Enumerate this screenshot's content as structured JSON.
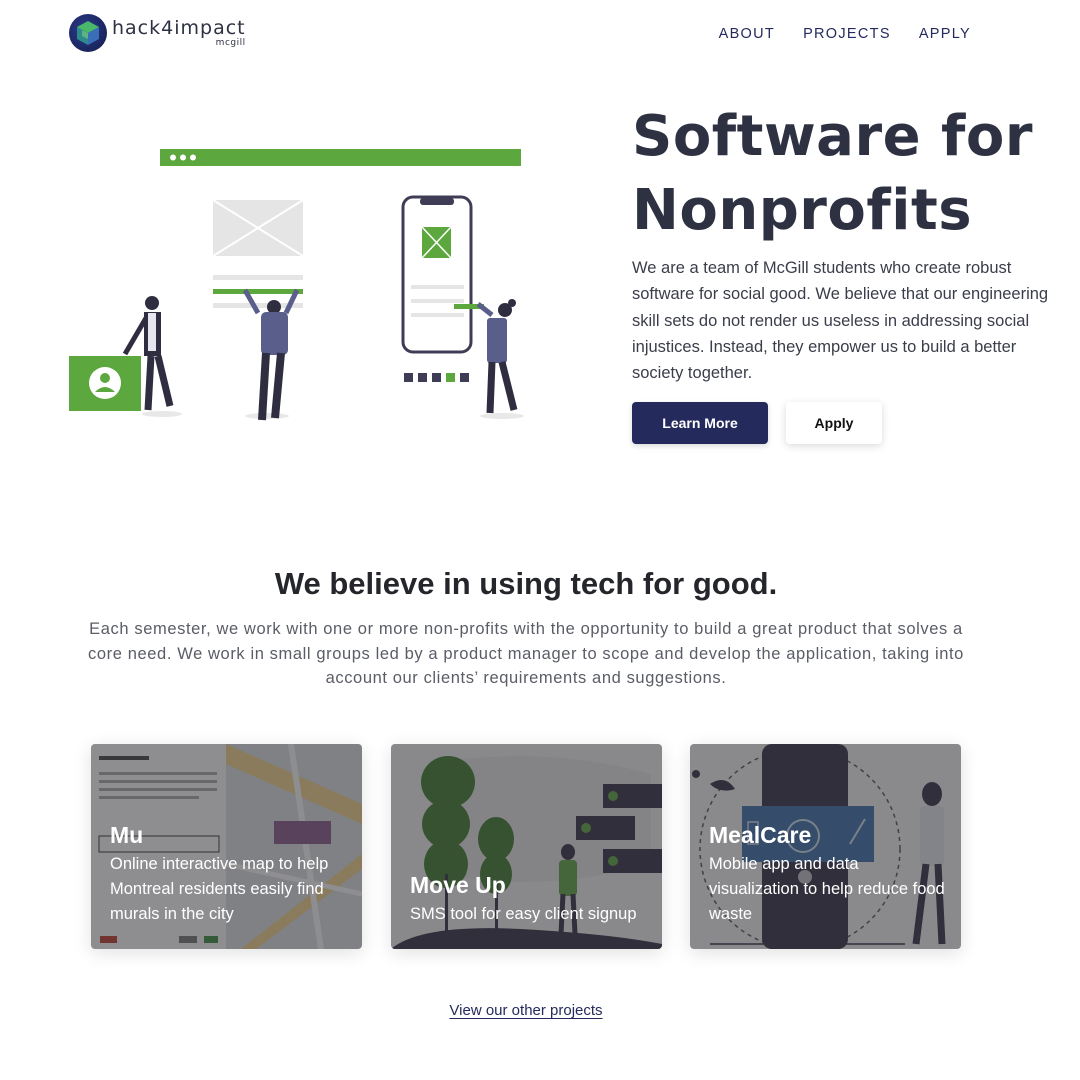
{
  "header": {
    "logo_name": "hack4impact",
    "logo_sub": "mcgill",
    "nav": [
      {
        "label": "ABOUT"
      },
      {
        "label": "PROJECTS"
      },
      {
        "label": "APPLY"
      }
    ]
  },
  "hero": {
    "title": "Software for Nonprofits",
    "description": "We are a team of McGill students who create robust software for social good. We believe that our engineering skill sets do not render us useless in addressing social injustices. Instead, they empower us to build a better society together.",
    "learn_more_label": "Learn More",
    "apply_label": "Apply"
  },
  "mission": {
    "title": "We believe in using tech for good.",
    "description": "Each semester, we work with one or more non-profits with the opportunity to build a great product that solves a core need. We work in small groups led by a product manager to scope and develop the application, taking into account our clients’ requirements and suggestions."
  },
  "projects": [
    {
      "title": "Mu",
      "description": "Online interactive map to help Montreal residents easily find murals in the city"
    },
    {
      "title": "Move Up",
      "description": "SMS tool for easy client signup"
    },
    {
      "title": "MealCare",
      "description": "Mobile app and data visualization to help reduce food waste"
    }
  ],
  "view_more_label": "View our other projects",
  "colors": {
    "navy": "#242a5c",
    "green": "#5da73f",
    "text_dark": "#2d3142"
  }
}
